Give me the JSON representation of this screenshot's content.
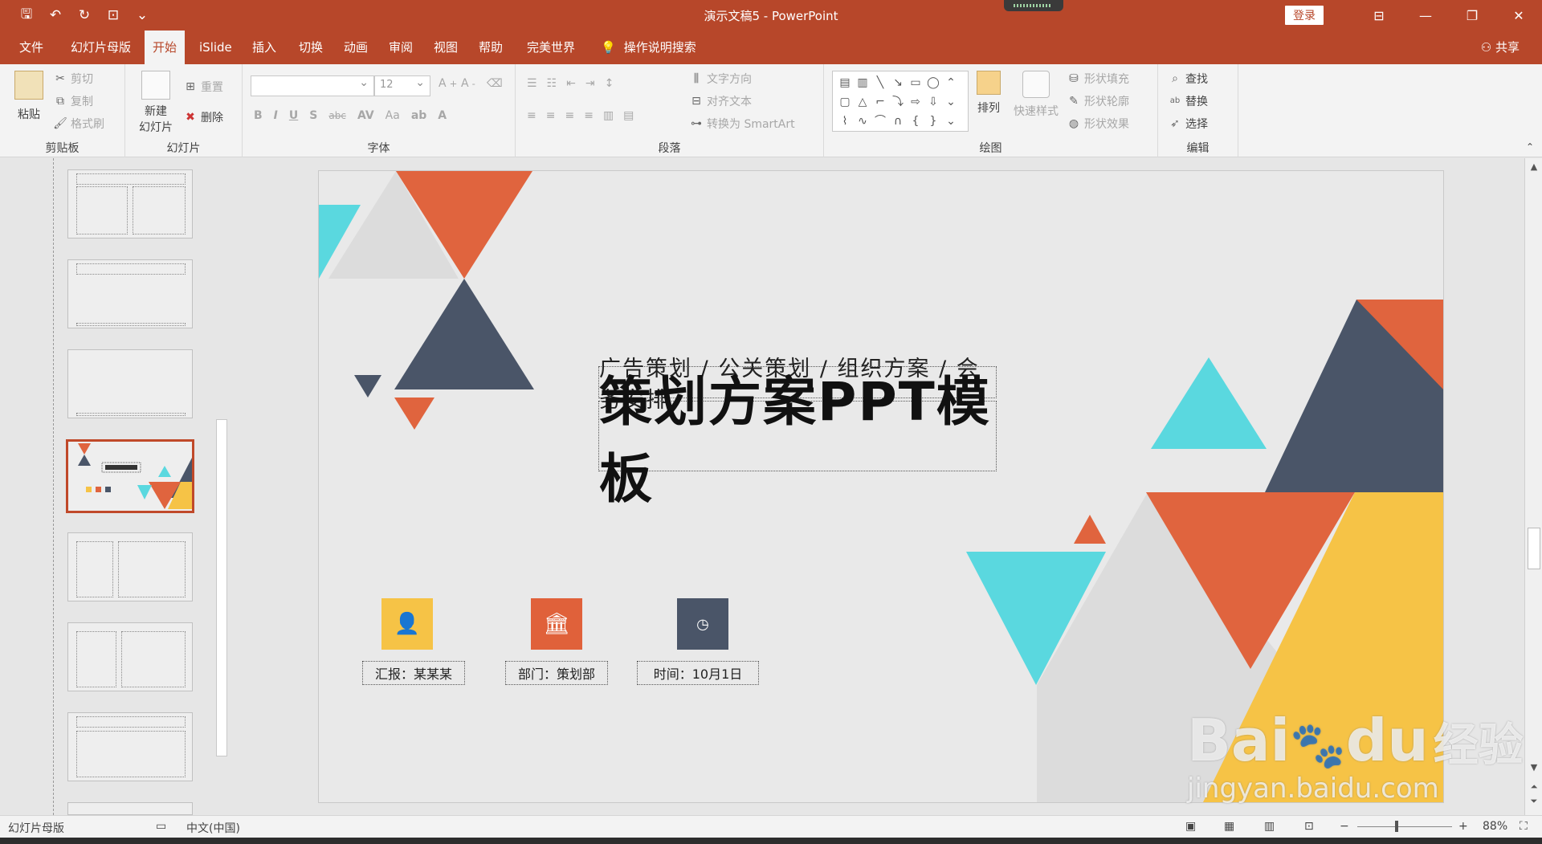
{
  "titlebar": {
    "title": "演示文稿5 - PowerPoint",
    "login": "登录",
    "icons": [
      "save-icon",
      "undo-icon",
      "redo-icon",
      "start-from-beginning-icon",
      "customize-icon"
    ],
    "controls": [
      "ribbon-display-icon",
      "minimize-icon",
      "restore-icon",
      "close-icon"
    ]
  },
  "tabs": [
    {
      "label": "文件"
    },
    {
      "label": "幻灯片母版"
    },
    {
      "label": "开始"
    },
    {
      "label": "iSlide"
    },
    {
      "label": "插入"
    },
    {
      "label": "切换"
    },
    {
      "label": "动画"
    },
    {
      "label": "审阅"
    },
    {
      "label": "视图"
    },
    {
      "label": "帮助"
    },
    {
      "label": "完美世界"
    }
  ],
  "help_search": "操作说明搜索",
  "share": "共享",
  "ribbon": {
    "clipboard": {
      "paste": "粘贴",
      "cut": "剪切",
      "copy": "复制",
      "format_painter": "格式刷",
      "label": "剪贴板"
    },
    "slides": {
      "new_slide": "新建",
      "new_slide2": "幻灯片",
      "reset": "重置",
      "delete": "删除",
      "label": "幻灯片"
    },
    "font": {
      "font_name": "",
      "font_size": "12",
      "label": "字体",
      "buttons": [
        "B",
        "I",
        "U",
        "S",
        "abc",
        "AV",
        "Aa"
      ]
    },
    "paragraph": {
      "text_direction": "文字方向",
      "align_text": "对齐文本",
      "smartart": "转换为 SmartArt",
      "label": "段落"
    },
    "drawing": {
      "arrange": "排列",
      "quick_styles": "快速样式",
      "shape_fill": "形状填充",
      "shape_outline": "形状轮廓",
      "shape_effects": "形状效果",
      "label": "绘图"
    },
    "editing": {
      "find": "查找",
      "replace": "替换",
      "select": "选择",
      "label": "编辑"
    }
  },
  "slide": {
    "subtitle": "广告策划  /  公关策划  /  组织方案  /  会务安排",
    "title": "策划方案PPT模板",
    "info": [
      {
        "label": "汇报：某某某",
        "color": "#f6c346",
        "icon": "user-icon"
      },
      {
        "label": "部门：策划部",
        "color": "#e0613a",
        "icon": "building-icon"
      },
      {
        "label": "时间：10月1日",
        "color": "#4a5568",
        "icon": "clock-24-icon"
      }
    ],
    "colors": {
      "orange": "#e0643e",
      "navy": "#4a5568",
      "cyan": "#5ad8df",
      "yellow": "#f6c346",
      "gray": "#dcdcdc"
    }
  },
  "watermark": {
    "brand": "Bai",
    "brand2": "du",
    "cn": "经验",
    "url": "jingyan.baidu.com"
  },
  "statusbar": {
    "mode": "幻灯片母版",
    "language": "中文(中国)",
    "zoom": "88%"
  }
}
